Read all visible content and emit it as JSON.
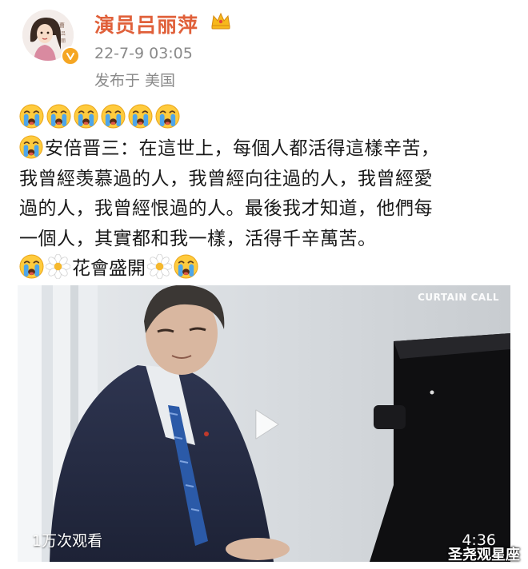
{
  "post": {
    "author": {
      "name": "演员吕丽萍",
      "avatar_signature": "曹吕丽萍"
    },
    "timestamp": "22-7-9 03:05",
    "source": "发布于 美国",
    "emoji_row": [
      "crying-face-emoji",
      "crying-face-emoji",
      "crying-face-emoji",
      "crying-face-emoji",
      "crying-face-emoji",
      "crying-face-emoji"
    ],
    "text_lines": [
      "安倍晋三：在這世上，每個人都活得這樣辛苦，",
      "我曾經羡慕過的人，我曾經向往過的人，我曾經愛",
      "過的人，我曾經恨過的人。最後我才知道，他們每",
      "一個人，其實都和我一樣，活得千辛萬苦。"
    ],
    "tag_text": "花會盛開"
  },
  "video": {
    "overlay_label": "CURTAIN CALL",
    "views": "1万次观看",
    "duration": "4:36"
  },
  "watermark": "圣尧观星座",
  "colors": {
    "author_name": "#e0603a",
    "meta_text": "#8a8a8a",
    "verified_badge": "#f5a623"
  }
}
